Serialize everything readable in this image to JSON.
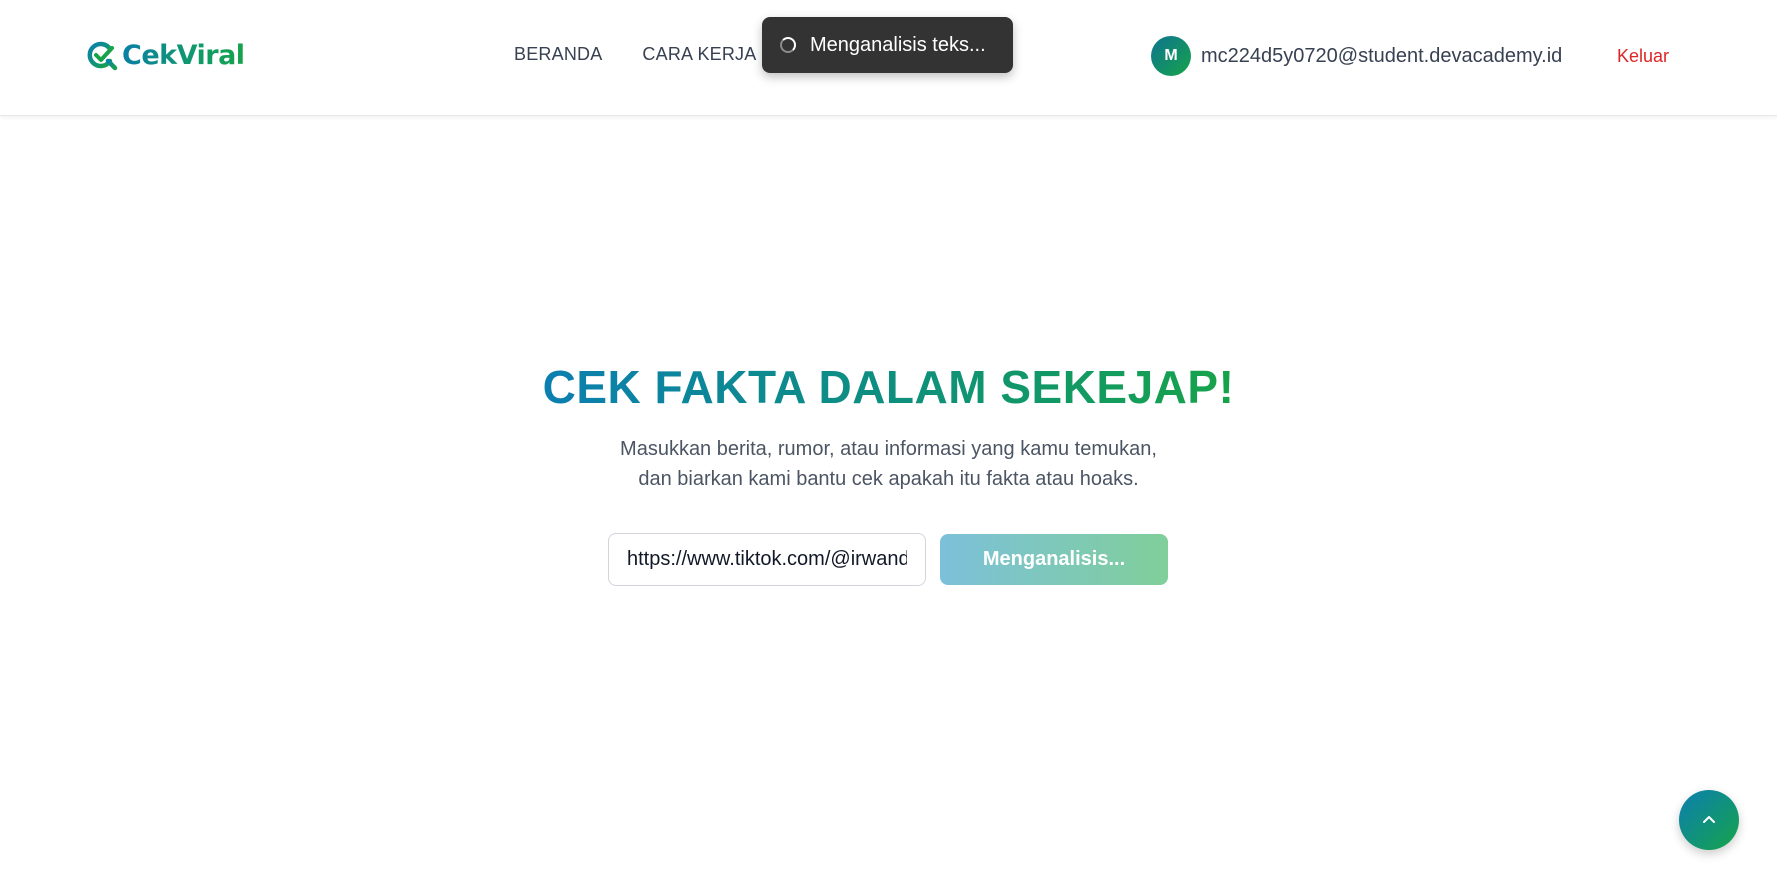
{
  "header": {
    "logo_text": "CekViral",
    "nav": [
      {
        "label": "BERANDA"
      },
      {
        "label": "CARA KERJA"
      }
    ],
    "user": {
      "avatar_initial": "M",
      "email": "mc224d5y0720@student.devacademy.id"
    },
    "logout_label": "Keluar"
  },
  "toast": {
    "message": "Menganalisis teks...",
    "icon": "spinner-icon"
  },
  "hero": {
    "title": "CEK FAKTA DALAM SEKEJAP!",
    "subtitle_line1": "Masukkan berita, rumor, atau informasi yang kamu temukan,",
    "subtitle_line2": "dan biarkan kami bantu cek apakah itu fakta atau hoaks."
  },
  "search": {
    "value": "https://www.tiktok.com/@irwandi",
    "button_label": "Menganalisis..."
  },
  "scroll_top": {
    "icon": "chevron-up-icon"
  },
  "colors": {
    "brand_blue": "#0b7fb0",
    "brand_green": "#16a34a",
    "logout_red": "#dc2626",
    "toast_bg": "#333333"
  }
}
